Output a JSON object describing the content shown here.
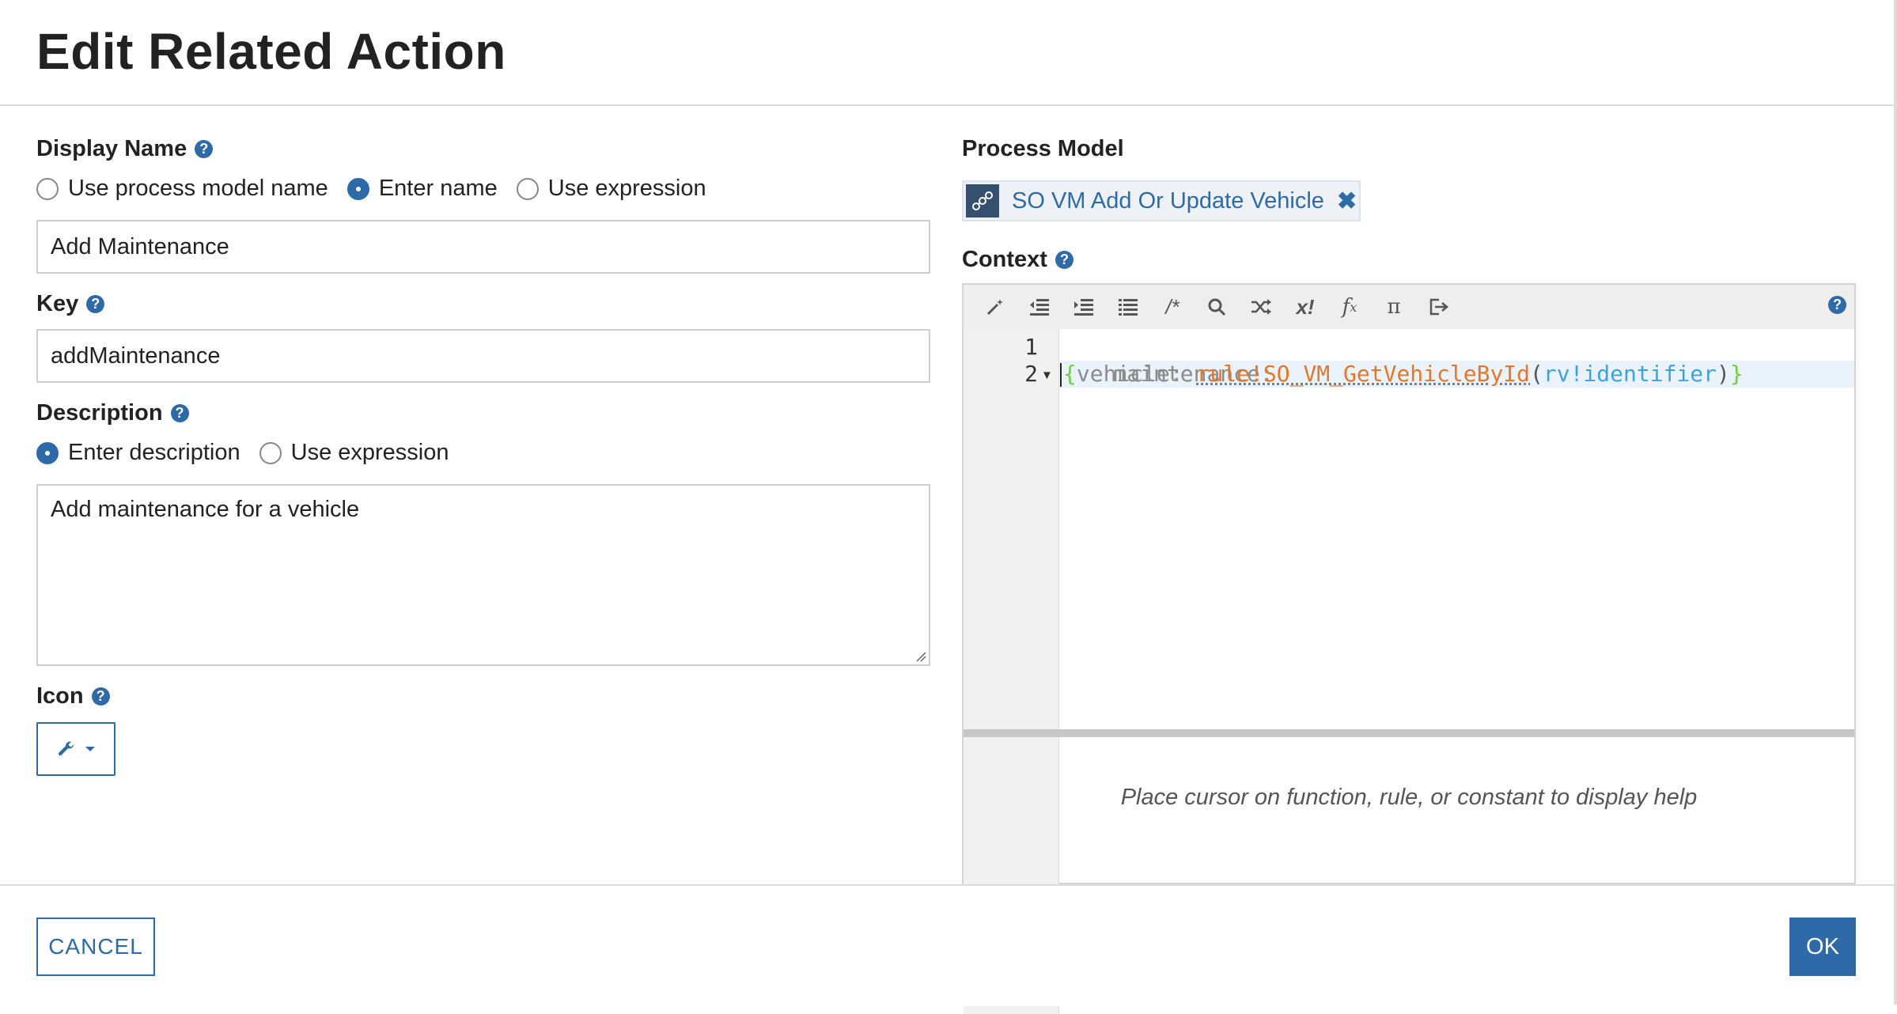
{
  "dialog": {
    "title": "Edit Related Action"
  },
  "display_name": {
    "label": "Display Name",
    "options": [
      "Use process model name",
      "Enter name",
      "Use expression"
    ],
    "selected": "Enter name",
    "value": "Add Maintenance"
  },
  "key": {
    "label": "Key",
    "value": "addMaintenance"
  },
  "description": {
    "label": "Description",
    "options": [
      "Enter description",
      "Use expression"
    ],
    "selected": "Enter description",
    "value": "Add maintenance for a vehicle"
  },
  "icon": {
    "label": "Icon",
    "selected_icon": "wrench-icon"
  },
  "process_model": {
    "label": "Process Model",
    "chip_text": "SO VM Add Or Update Vehicle",
    "chip_icon": "process-model-icon"
  },
  "context": {
    "label": "Context",
    "toolbar_icons": [
      "magic-wand-icon",
      "outdent-icon",
      "indent-icon",
      "list-icon",
      "comment-icon",
      "search-icon",
      "shuffle-icon",
      "local-variable-icon",
      "function-icon",
      "pi-icon",
      "export-icon"
    ],
    "line_numbers": [
      "1",
      "2"
    ],
    "code": {
      "line1": "maintenance:",
      "brace_open": "{",
      "key": "vehicle:",
      "rule": "rule!SO_VM_GetVehicleById",
      "paren_open": "(",
      "arg": "rv!identifier",
      "paren_close": ")",
      "brace_close": "}"
    },
    "help_text": "Place cursor on function, rule, or constant to display help"
  },
  "footer": {
    "cancel_label": "CANCEL",
    "ok_label": "OK"
  },
  "colors": {
    "accent": "#2e6aa7",
    "rule": "#e0792b",
    "rule_input": "#3ea3dd",
    "brace": "#6ccf3f"
  }
}
